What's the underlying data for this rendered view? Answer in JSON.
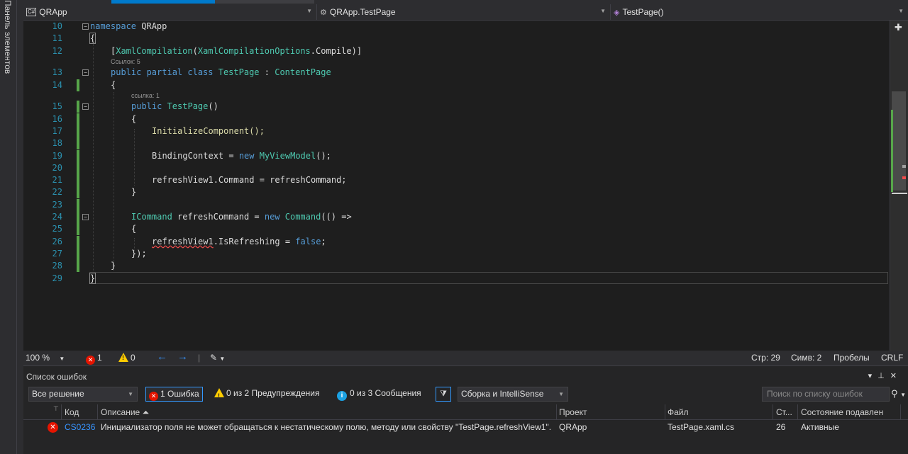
{
  "toolbox": {
    "label": "Панель элементов"
  },
  "navbar": {
    "project": "QRApp",
    "project_badge": "C#",
    "class": "QRApp.TestPage",
    "member": "TestPage()"
  },
  "editor": {
    "lines": [
      {
        "num": "10"
      },
      {
        "num": "11"
      },
      {
        "num": "12"
      },
      {
        "num": "13"
      },
      {
        "num": "14"
      },
      {
        "num": "15"
      },
      {
        "num": "16"
      },
      {
        "num": "17"
      },
      {
        "num": "18"
      },
      {
        "num": "19"
      },
      {
        "num": "20"
      },
      {
        "num": "21"
      },
      {
        "num": "22"
      },
      {
        "num": "23"
      },
      {
        "num": "24"
      },
      {
        "num": "25"
      },
      {
        "num": "26"
      },
      {
        "num": "27"
      },
      {
        "num": "28"
      },
      {
        "num": "29"
      }
    ],
    "code": {
      "l10_kw": "namespace",
      "l10_name": " QRApp",
      "l11": "{",
      "l12_open": "[",
      "l12_attr": "XamlCompilation",
      "l12_paren": "(",
      "l12_enum": "XamlCompilationOptions",
      "l12_rest": ".Compile)]",
      "lens_class": "Ссылок: 5",
      "l13_kw": "public partial class",
      "l13_name": " TestPage",
      "l13_colon": " : ",
      "l13_base": "ContentPage",
      "l14": "{",
      "lens_ctor": "ссылка: 1",
      "l15_kw": "public",
      "l15_name": " TestPage",
      "l15_rest": "()",
      "l16": "{",
      "l17": "InitializeComponent();",
      "l19_a": "BindingContext = ",
      "l19_kw": "new",
      "l19_type": " MyViewModel",
      "l19_rest": "();",
      "l21": "refreshView1.Command = refreshCommand;",
      "l22": "}",
      "l24_type": "ICommand",
      "l24_a": " refreshCommand = ",
      "l24_kw": "new",
      "l24_type2": " Command",
      "l24_rest": "(() =>",
      "l25": "{",
      "l26_a": "refreshView1",
      "l26_b": ".IsRefreshing = ",
      "l26_kw": "false",
      "l26_rest": ";",
      "l27": "});",
      "l28": "}",
      "l29": "}"
    }
  },
  "editor_status": {
    "zoom": "100 %",
    "errors": "1",
    "warnings": "0",
    "line": "Стр: 29",
    "col": "Симв: 2",
    "whitespace": "Пробелы",
    "eol": "CRLF"
  },
  "error_list": {
    "title": "Список ошибок",
    "scope": "Все решение",
    "errors_btn": "1 Ошибка",
    "warnings_btn": "0 из 2 Предупреждения",
    "messages_btn": "0 из 3 Сообщения",
    "build_filter": "Сборка и IntelliSense",
    "search_placeholder": "Поиск по списку ошибок",
    "columns": {
      "code": "Код",
      "description": "Описание",
      "project": "Проект",
      "file": "Файл",
      "line": "Ст...",
      "suppression": "Состояние подавлен"
    },
    "rows": [
      {
        "code": "CS0236",
        "description": "Инициализатор поля не может обращаться к нестатическому полю, методу или свойству \"TestPage.refreshView1\".",
        "project": "QRApp",
        "file": "TestPage.xaml.cs",
        "line": "26",
        "state": "Активные"
      }
    ]
  },
  "colors": {
    "accent": "#007acc",
    "keyword": "#569cd6",
    "type": "#4ec9b0",
    "line_number": "#2b91af",
    "error": "#e51400",
    "change_bar": "#57a64a"
  }
}
